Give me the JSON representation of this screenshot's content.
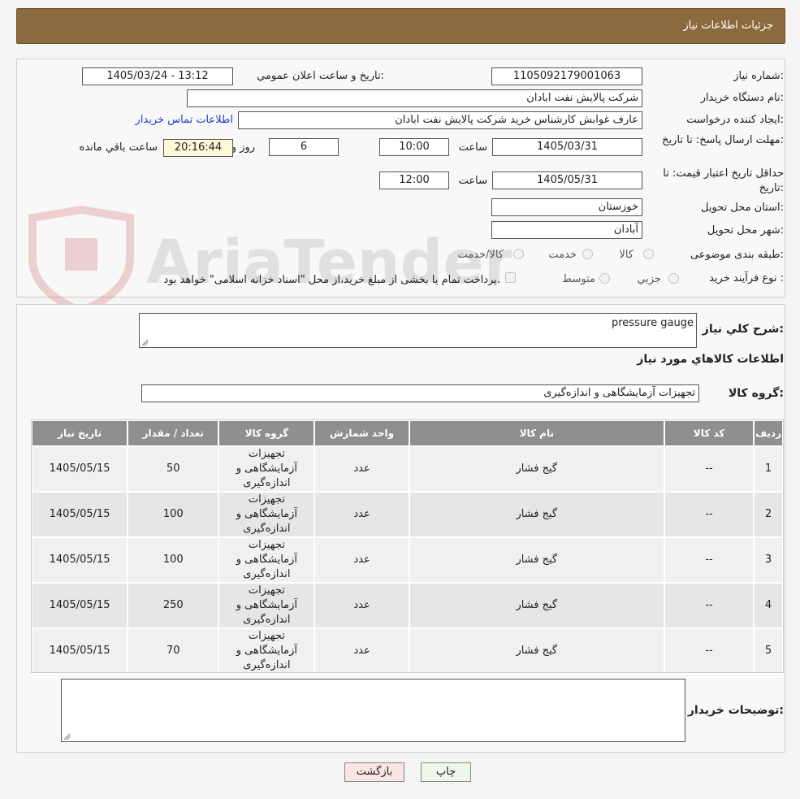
{
  "header": {
    "title": "جزئیات اطلاعات نیاز"
  },
  "form": {
    "need_number_label": "شماره نیاز:",
    "need_number": "1105092179001063",
    "announce_label": "تاریخ و ساعت اعلان عمومي:",
    "announce_value": "1405/03/24 - 13:12",
    "buyer_org_label": "نام دستگاه خريدار:",
    "buyer_org": "شرکت پالایش نفت ابادان",
    "creator_label": "ايجاد کننده درخواست:",
    "creator": "عارف غوابش کارشناس خرید شرکت پالایش نفت ابادان",
    "contact_link": "اطلاعات تماس خريدار",
    "deadline_label": "مهلت ارسال پاسخ: تا تاريخ:",
    "deadline_date": "1405/03/31",
    "time_label": "ساعت",
    "deadline_time": "10:00",
    "days_value": "6",
    "days_label": "روز و",
    "remaining_time": "20:16:44",
    "remaining_label": "ساعت باقي مانده",
    "validity_label": "حداقل تاريخ اعتبار قيمت: تا تاريخ:",
    "validity_date": "1405/05/31",
    "validity_time": "12:00",
    "province_label": "استان محل تحويل:",
    "province": "خوزستان",
    "city_label": "شهر محل تحويل:",
    "city": "آبادان",
    "category_label": "طبقه بندی موضوعی:",
    "category_options": [
      "کالا",
      "خدمت",
      "کالا/خدمت"
    ],
    "process_label": "نوع فرآيند خريد :",
    "process_options": [
      "جزيي",
      "متوسط"
    ],
    "payment_note": "پرداخت تمام يا بخشی از مبلغ خريد،از محل \"اسناد خزانه اسلامی\" خواهد بود."
  },
  "watermark": "AriaTender.neT",
  "details": {
    "summary_label": "شرح کلي نياز:",
    "summary_value": "pressure gauge",
    "goods_info_title": "اطلاعات کالاهاي مورد نياز",
    "goods_group_label": "گروه کالا:",
    "goods_group_value": "تجهیزات آزمایشگاهی و اندازه‌گیری"
  },
  "table": {
    "headers": [
      "رديف",
      "کد کالا",
      "نام کالا",
      "واحد شمارش",
      "گروه کالا",
      "تعداد / مقدار",
      "تاريخ نياز"
    ],
    "rows": [
      [
        "1",
        "--",
        "گیج فشار",
        "عدد",
        "تجهیزات آزمایشگاهی و اندازه‌گیری",
        "50",
        "1405/05/15"
      ],
      [
        "2",
        "--",
        "گیج فشار",
        "عدد",
        "تجهیزات آزمایشگاهی و اندازه‌گیری",
        "100",
        "1405/05/15"
      ],
      [
        "3",
        "--",
        "گیج فشار",
        "عدد",
        "تجهیزات آزمایشگاهی و اندازه‌گیری",
        "100",
        "1405/05/15"
      ],
      [
        "4",
        "--",
        "گیج فشار",
        "عدد",
        "تجهیزات آزمایشگاهی و اندازه‌گیری",
        "250",
        "1405/05/15"
      ],
      [
        "5",
        "--",
        "گیج فشار",
        "عدد",
        "تجهیزات آزمایشگاهی و اندازه‌گیری",
        "70",
        "1405/05/15"
      ]
    ]
  },
  "notes": {
    "label": "توضيحات خريدار:",
    "value": ""
  },
  "buttons": {
    "print": "چاپ",
    "back": "بازگشت"
  }
}
